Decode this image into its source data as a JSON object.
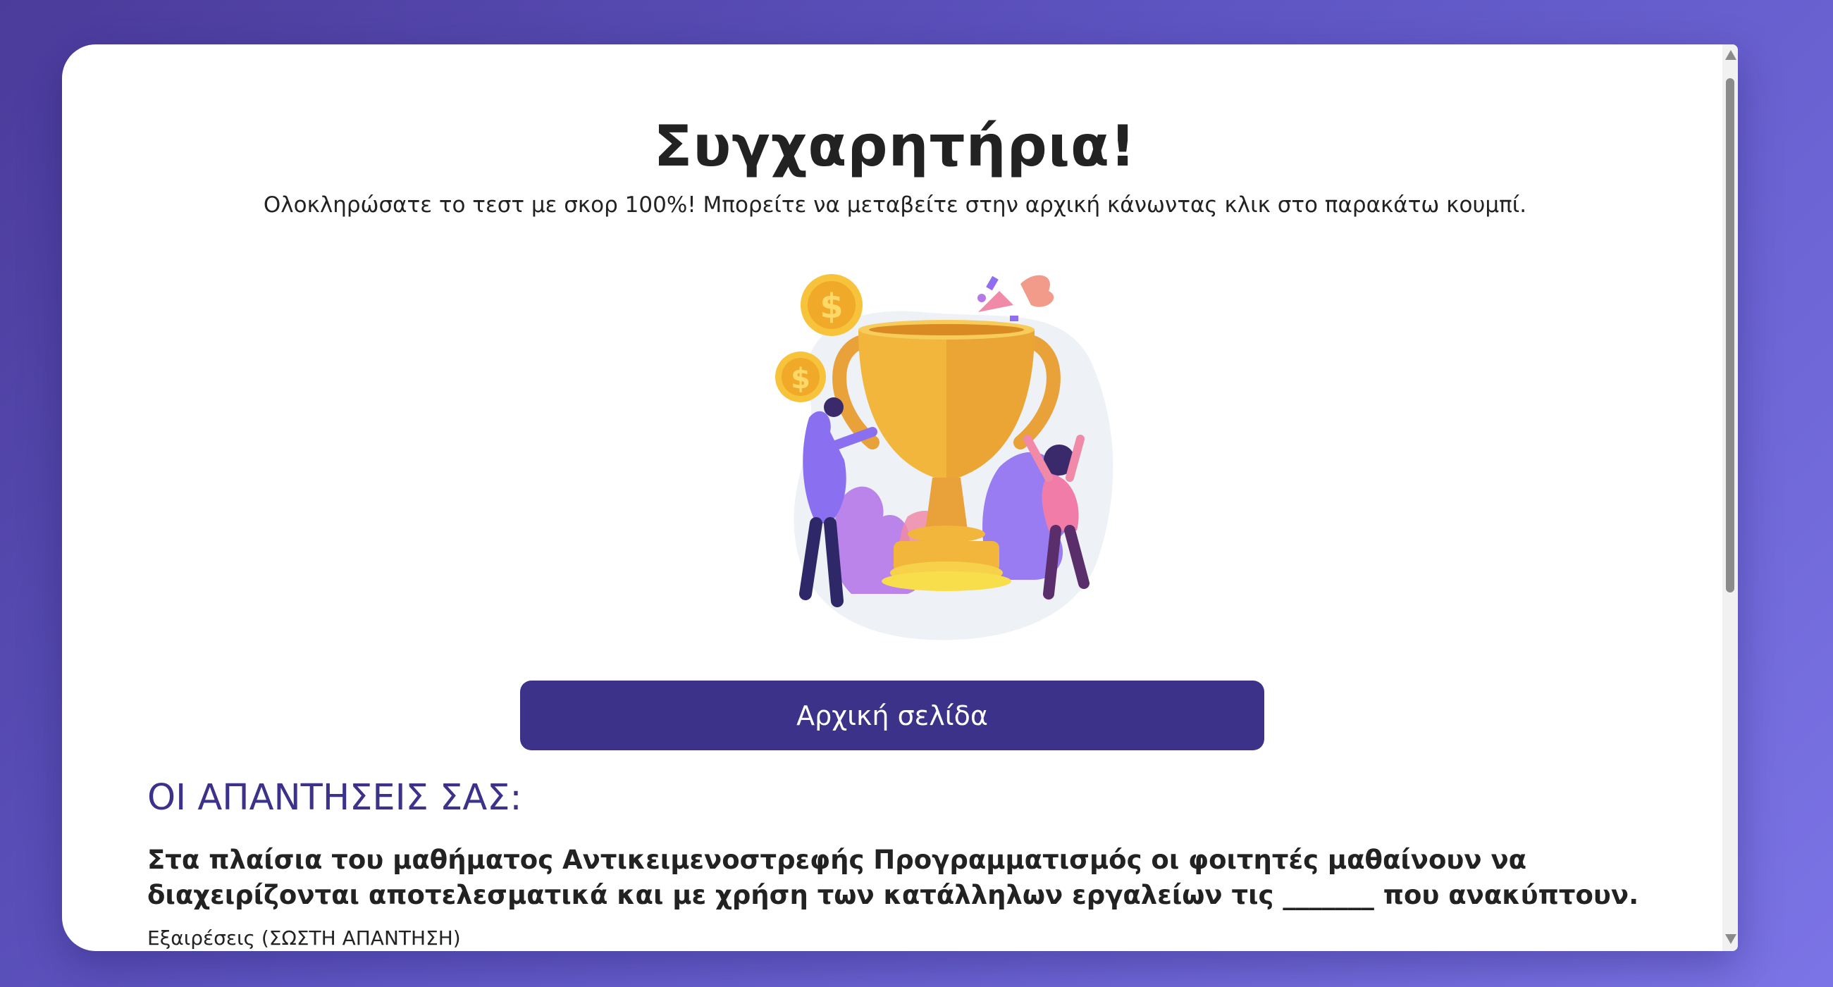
{
  "page": {
    "title": "Συγχαρητήρια!",
    "subtitle": "Ολοκληρώσατε το τεστ με σκορ 100%! Μπορείτε να μεταβείτε στην αρχική κάνωντας κλικ στο παρακάτω κουμπί.",
    "illustration": "trophy-celebration-illustration",
    "home_button_label": "Αρχική σελίδα"
  },
  "answers": {
    "heading": "ΟΙ ΑΠΑΝΤΗΣΕΙΣ ΣΑΣ:",
    "question": "Στα πλαίσια του μαθήματος Αντικειμενοστρεφής Προγραμματισμός οι φοιτητές μαθαίνουν να διαχειρίζονται αποτελεσματικά και με χρήση των κατάλληλων εργαλείων τις _______ που ανακύπτουν.",
    "answer": "Εξαιρέσεις (ΣΩΣΤΗ ΑΠΑΝΤΗΣΗ)"
  },
  "colors": {
    "accent": "#3d3289",
    "background_start": "#4b3b9a",
    "background_end": "#7b74e6",
    "trophy_gold": "#f2b63c"
  }
}
